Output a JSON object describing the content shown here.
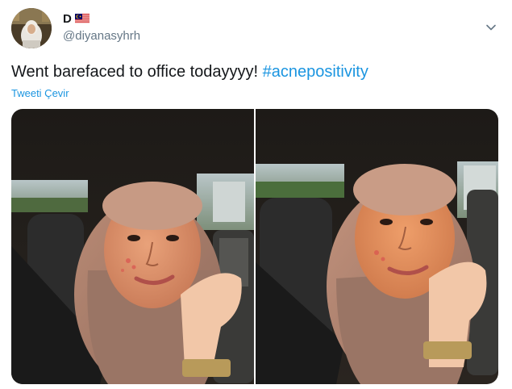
{
  "tweet": {
    "display_name": "D",
    "flag": "malaysia-flag-icon",
    "handle": "@diyanasyhrh",
    "text_plain": "Went barefaced to office todayyyy! ",
    "hashtag": "#acnepositivity",
    "translate_label": "Tweeti Çevir",
    "media_count": 2
  },
  "colors": {
    "link": "#1b95e0",
    "secondary_text": "#657786",
    "primary_text": "#14171a"
  },
  "icons": {
    "menu": "chevron-down-icon"
  }
}
